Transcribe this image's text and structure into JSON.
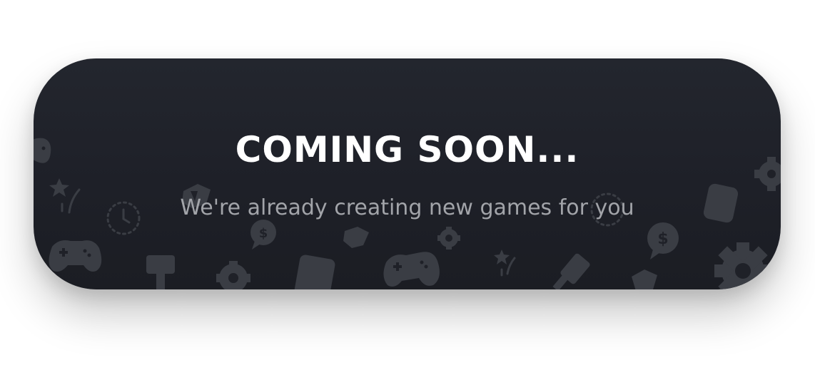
{
  "banner": {
    "title": "COMING SOON...",
    "subtitle": "We're already creating new games for you"
  },
  "background_icons": [
    "gamepad-icon",
    "star-sparkle-icon",
    "clock-icon",
    "gift-icon",
    "coin-bubble-icon",
    "gear-icon",
    "hammer-icon",
    "phone-icon",
    "gamepad-icon",
    "hammer-icon",
    "coin-bubble-icon",
    "gift-icon",
    "gear-icon",
    "clock-icon",
    "phone-icon",
    "star-sparkle-icon"
  ],
  "colors": {
    "card_background": "#1f2128",
    "title": "#ffffff",
    "subtitle": "#a2a4a9",
    "icon_pattern": "#3a3d44"
  }
}
